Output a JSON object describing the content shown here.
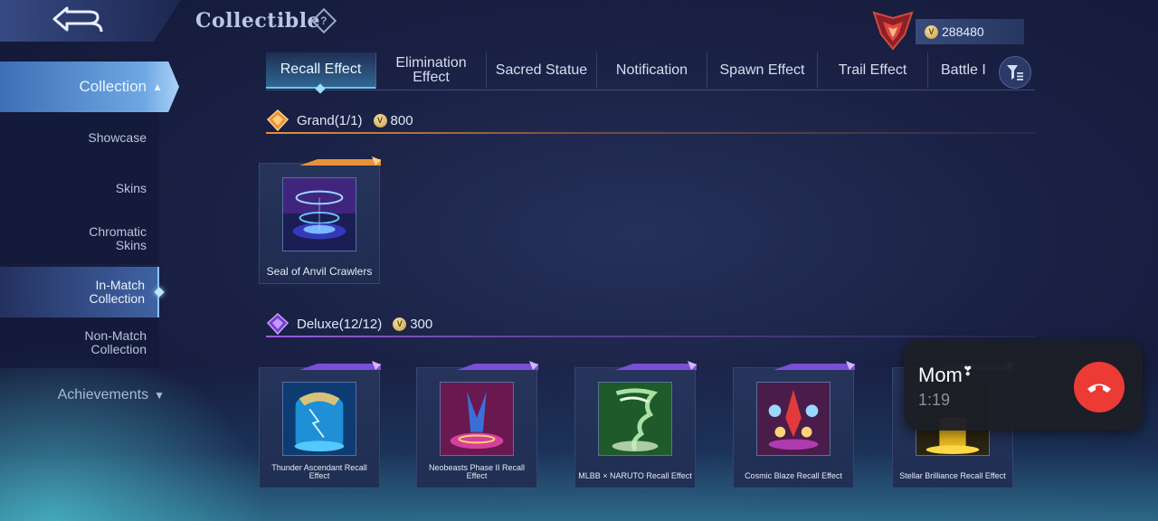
{
  "header": {
    "title": "Collectible",
    "help_glyph": "?",
    "currency_value": "288480",
    "coin_icon": "coin-icon",
    "rank_icon": "rank-emblem-icon"
  },
  "sidebar": {
    "collection_label": "Collection",
    "items": [
      {
        "label": "Showcase"
      },
      {
        "label": "Skins"
      },
      {
        "label": "Chromatic Skins"
      },
      {
        "label": "In-Match Collection",
        "active": true
      },
      {
        "label": "Non-Match Collection"
      }
    ],
    "achievements_label": "Achievements"
  },
  "tabs": [
    {
      "label": "Recall Effect",
      "active": true
    },
    {
      "label": "Elimination Effect"
    },
    {
      "label": "Sacred Statue"
    },
    {
      "label": "Notification"
    },
    {
      "label": "Spawn Effect"
    },
    {
      "label": "Trail Effect"
    },
    {
      "label": "Battle I"
    }
  ],
  "sections": {
    "grand": {
      "title": "Grand(1/1)",
      "price": "800",
      "items": [
        {
          "name": "Seal of Anvil Crawlers"
        }
      ]
    },
    "deluxe": {
      "title": "Deluxe(12/12)",
      "price": "300",
      "items": [
        {
          "name": "Thunder Ascendant Recall Effect"
        },
        {
          "name": "Neobeasts Phase II Recall Effect"
        },
        {
          "name": "MLBB × NARUTO Recall Effect"
        },
        {
          "name": "Cosmic Blaze Recall Effect"
        },
        {
          "name": "Stellar Brilliance Recall Effect"
        }
      ]
    }
  },
  "call": {
    "caller": "Mom",
    "duration": "1:19"
  },
  "colors": {
    "accent": "#6cc6f0",
    "grand": "#e8913a",
    "deluxe": "#9a5ce0",
    "hangup": "#ec3b35"
  }
}
